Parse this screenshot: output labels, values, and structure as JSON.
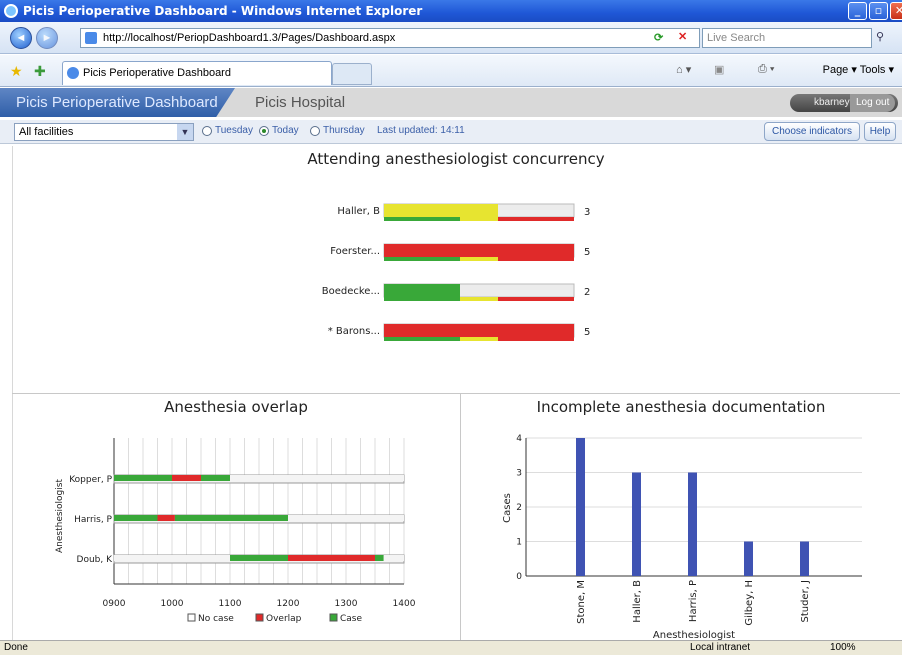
{
  "window": {
    "title": "Picis Perioperative Dashboard - Windows Internet Explorer",
    "url": "http://localhost/PeriopDashboard1.3/Pages/Dashboard.aspx",
    "search_placeholder": "Live Search",
    "tab_title": "Picis Perioperative Dashboard",
    "commands": "Page ▾  Tools ▾",
    "status_left": "Done",
    "status_zone": "Local intranet",
    "status_zoom": "100%"
  },
  "app": {
    "name": "Picis Perioperative Dashboard",
    "hospital": "Picis Hospital",
    "user": "kbarney",
    "logout_label": "Log out"
  },
  "filters": {
    "facility": "All facilities",
    "days": [
      {
        "label": "Tuesday",
        "selected": false
      },
      {
        "label": "Today",
        "selected": true
      },
      {
        "label": "Thursday",
        "selected": false
      }
    ],
    "last_updated": "Last updated: 14:11",
    "choose_indicators_label": "Choose indicators",
    "help_label": "Help"
  },
  "colors": {
    "red": "#e02a2a",
    "green": "#39a839",
    "yellow": "#e7e430",
    "gray": "#ececec",
    "bar_blue": "#3f53b3"
  },
  "chart_data": [
    {
      "type": "bar",
      "title": "Attending anesthesiologist concurrency",
      "categories": [
        "Haller, B",
        "Foerster...",
        "Boedecke...",
        "* Barons..."
      ],
      "values": [
        3,
        5,
        2,
        5
      ],
      "max": 5
    },
    {
      "type": "bar",
      "title": "Anesthesia overlap",
      "ylabel": "Anesthesiologist",
      "categories": [
        "Kopper, P",
        "Harris, P",
        "Doub, K"
      ],
      "xlim": [
        900,
        1400
      ],
      "xticks": [
        "0900",
        "1000",
        "1100",
        "1200",
        "1300",
        "1400"
      ],
      "legend": [
        "No case",
        "Overlap",
        "Case"
      ],
      "segments": [
        [
          {
            "from": 900,
            "to": 1000,
            "kind": "Case"
          },
          {
            "from": 1000,
            "to": 1050,
            "kind": "Overlap"
          },
          {
            "from": 1050,
            "to": 1100,
            "kind": "Case"
          },
          {
            "from": 1100,
            "to": 1400,
            "kind": "No case"
          }
        ],
        [
          {
            "from": 900,
            "to": 975,
            "kind": "Case"
          },
          {
            "from": 975,
            "to": 1005,
            "kind": "Overlap"
          },
          {
            "from": 1005,
            "to": 1200,
            "kind": "Case"
          },
          {
            "from": 1200,
            "to": 1400,
            "kind": "No case"
          }
        ],
        [
          {
            "from": 900,
            "to": 1100,
            "kind": "No case"
          },
          {
            "from": 1100,
            "to": 1200,
            "kind": "Case"
          },
          {
            "from": 1200,
            "to": 1350,
            "kind": "Overlap"
          },
          {
            "from": 1350,
            "to": 1365,
            "kind": "Case"
          },
          {
            "from": 1365,
            "to": 1400,
            "kind": "No case"
          }
        ]
      ]
    },
    {
      "type": "bar",
      "title": "Incomplete anesthesia documentation",
      "xlabel": "Anesthesiologist",
      "ylabel": "Cases",
      "categories": [
        "Stone, M",
        "Haller, B",
        "Harris, P",
        "Gilbey, H",
        "Studer, J"
      ],
      "values": [
        4,
        3,
        3,
        1,
        1
      ],
      "ylim": [
        0,
        4
      ],
      "yticks": [
        "0",
        "1",
        "2",
        "3",
        "4"
      ]
    }
  ]
}
